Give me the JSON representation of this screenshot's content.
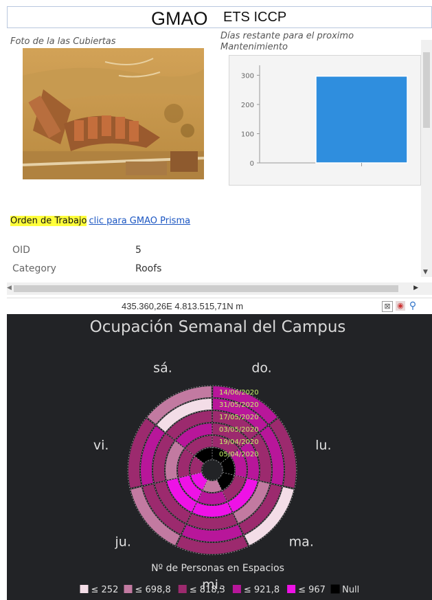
{
  "header": {
    "title": "GMAO",
    "subtitle": "ETS ICCP"
  },
  "popup": {
    "photo_label": "Foto de la las Cubiertas",
    "chart_label": "Días restante para el proximo Mantenimiento",
    "work_order": {
      "label": "Orden de Trabajo",
      "link": "clic para GMAO Prisma"
    },
    "attributes": [
      {
        "name": "OID",
        "value": "5"
      },
      {
        "name": "Category",
        "value": "Roofs"
      }
    ]
  },
  "statusbar": {
    "coordinates": "435.360,26E 4.813.515,71N m",
    "icons": [
      "filter-icon",
      "locate-icon",
      "zoom-icon"
    ]
  },
  "chart_data": [
    {
      "type": "bar",
      "categories": [
        ""
      ],
      "values": [
        297
      ],
      "ylim": [
        0,
        320
      ],
      "yticks": [
        0,
        100,
        200,
        300
      ],
      "color": "#2f8ede"
    },
    {
      "type": "heatmap",
      "title": "Ocupación Semanal del Campus",
      "days": [
        "do.",
        "lu.",
        "ma.",
        "mi.",
        "ju.",
        "vi.",
        "sá."
      ],
      "weeks": [
        "14/06/2020",
        "31/05/2020",
        "17/05/2020",
        "03/05/2020",
        "19/04/2020",
        "05/04/2020"
      ],
      "values": [
        [
          900,
          870,
          800,
          720,
          760,
          1200
        ],
        [
          700,
          900,
          800,
          850,
          880,
          1200
        ],
        [
          200,
          800,
          300,
          960,
          700,
          1200
        ],
        [
          700,
          920,
          750,
          967,
          900,
          650
        ],
        [
          690,
          700,
          760,
          965,
          960,
          960
        ],
        [
          700,
          830,
          760,
          680,
          740,
          700
        ],
        [
          600,
          200,
          760,
          880,
          700,
          1200
        ]
      ],
      "legend_title": "Nº de Personas en Espacios",
      "legend": [
        {
          "label": "≤ 252",
          "color": "#f3dde7",
          "max": 252
        },
        {
          "label": "≤ 698,8",
          "color": "#c27aa1",
          "max": 698.8
        },
        {
          "label": "≤ 818,3",
          "color": "#9c2a6e",
          "max": 818.3
        },
        {
          "label": "≤ 921,8",
          "color": "#b8169a",
          "max": 921.8
        },
        {
          "label": "≤ 967",
          "color": "#ee12e6",
          "max": 967
        },
        {
          "label": "Null",
          "color": "#000000",
          "max": null
        }
      ]
    }
  ]
}
